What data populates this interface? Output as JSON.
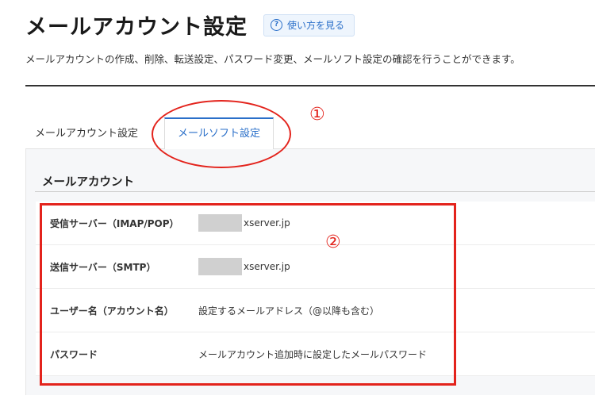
{
  "header": {
    "title": "メールアカウント設定",
    "help_label": "使い方を見る",
    "help_icon_glyph": "?",
    "description": "メールアカウントの作成、削除、転送設定、パスワード変更、メールソフト設定の確認を行うことができます。"
  },
  "tabs": [
    {
      "label": "メールアカウント設定",
      "active": false
    },
    {
      "label": "メールソフト設定",
      "active": true
    }
  ],
  "section": {
    "title": "メールアカウント",
    "rows": [
      {
        "label": "受信サーバー（IMAP/POP）",
        "value": "xserver.jp",
        "masked": true
      },
      {
        "label": "送信サーバー（SMTP）",
        "value": "xserver.jp",
        "masked": true
      },
      {
        "label": "ユーザー名（アカウント名）",
        "value": "設定するメールアドレス（@以降も含む）",
        "masked": false
      },
      {
        "label": "パスワード",
        "value": "メールアカウント追加時に設定したメールパスワード",
        "masked": false
      }
    ]
  },
  "annotations": {
    "mark1": "①",
    "mark2": "②",
    "color": "#e3231c"
  },
  "colors": {
    "accent": "#2a6fc9",
    "panel_bg": "#f6f7f9"
  }
}
